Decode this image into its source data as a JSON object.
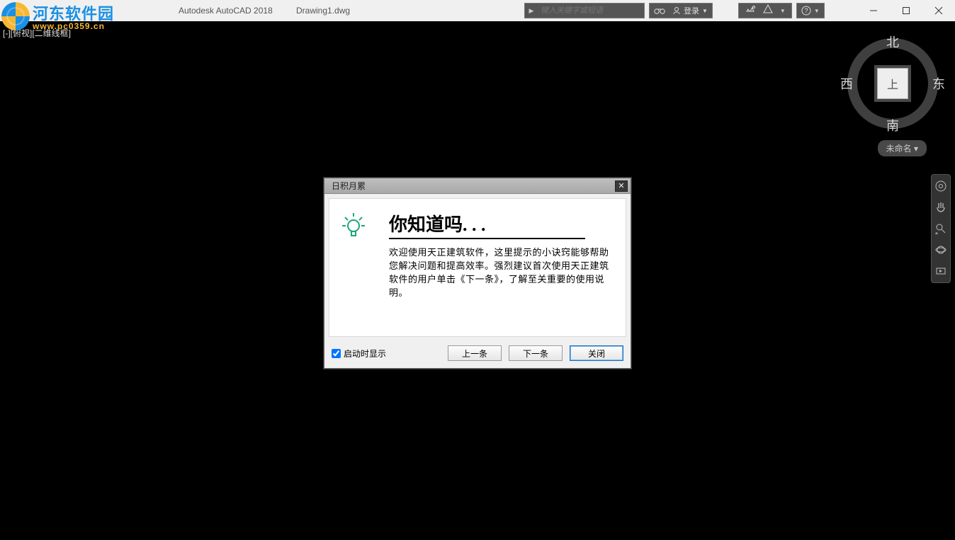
{
  "titlebar": {
    "app": "Autodesk AutoCAD 2018",
    "doc": "Drawing1.dwg"
  },
  "watermark": {
    "line1": "河东软件园",
    "line2": "www.pc0359.cn"
  },
  "search": {
    "placeholder": "键入关键字或短语"
  },
  "account": {
    "login": "登录"
  },
  "viewlabel": "[-][俯视][二维线框]",
  "compass": {
    "n": "北",
    "s": "南",
    "e": "东",
    "w": "西",
    "cube": "上"
  },
  "wcs": "未命名 ▾",
  "dialog": {
    "title": "日积月累",
    "heading": "你知道吗. . .",
    "body": "欢迎使用天正建筑软件，这里提示的小诀窍能够帮助您解决问题和提高效率。强烈建议首次使用天正建筑软件的用户单击《下一条》，了解至关重要的使用说明。",
    "show_on_start": "启动时显示",
    "prev": "上一条",
    "next": "下一条",
    "close": "关闭"
  }
}
